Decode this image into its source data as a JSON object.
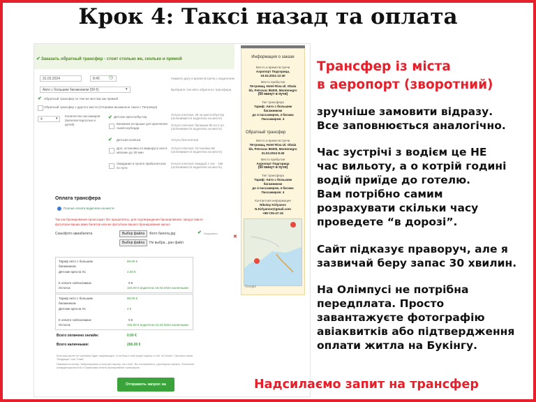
{
  "title": "Крок 4: Таксі назад та оплата",
  "form": {
    "banner": "Заказать обратный трансфер - стоит столько же, сколько и прямой",
    "date": "31.03.2024",
    "time": "8:45",
    "time_hint": "Укажите дату и время встречи с водителем",
    "car": "Авто с большим багажником (99 €)",
    "car_hint": "Выберите тип авто обратного трансфера",
    "opt_same": "Обратный трансфер по тем же местам как прямой",
    "opt_other": "Обратный трансфер с другого места (Отправка вызванное такси с Петровца)",
    "pax_label": "Количество пассажиров (включая взрослых и детей)",
    "pax_value": "4",
    "services": [
      {
        "label": "Детское кресло/бустер",
        "checked": true,
        "hint": "Услуга платная: 4€ за кресло/бустер (оплачивается водителю на месте)"
      },
      {
        "label": "Багажник на крыше для крепления лыж/сноуборда",
        "checked": false,
        "hint": "Услуга платная: багажник 8€ на 2 шт (оплачивается водителю на месте)"
      },
      {
        "label": "Детская коляска",
        "checked": true,
        "hint": "Услуга бесплатная"
      },
      {
        "label": "Доп. остановка по маршруту или в магазин до 30 мин",
        "checked": false,
        "hint": "Услуга платная: Остановка 8€ (оплачивается водителю на месте)"
      },
      {
        "label": "Ожидание в пункте прибытия или по пути",
        "checked": false,
        "hint": "Услуга платная: Каждый 1 час - 16€ (оплачивается водителю на месте)"
      }
    ],
    "payment_title": "Оплата трансфера",
    "payment_option": "Полная оплата водителю на месте",
    "payment_warning_1": "Так как бронирование происходит без предоплаты, для подтверждения бронирования, предоставьте",
    "payment_warning_2": "фото/скан ваших авиа билетов или же фото/скан вашего бронирования жилья",
    "scan_label": "Скан/фото авиабилета",
    "file_btn": "Выбор файла",
    "file1": "Фото билета.jpg",
    "file1_status": "Загружено",
    "file2": "Не выбра...ран файл",
    "table1": [
      [
        "Тариф Авто с большим",
        "99.00 €"
      ],
      [
        "багажником",
        ""
      ],
      [
        "Детские кресла Х1",
        "4.00 €"
      ],
      [
        "К оплате сейчас/аванс",
        "0 €"
      ],
      [
        "Остаток",
        "103.00 € водителю 19.03.2024 наличными"
      ]
    ],
    "table2": [
      [
        "Тариф Авто с большим",
        "99.00 €"
      ],
      [
        "багажником",
        ""
      ],
      [
        "Детские кресла Х1",
        "4 €"
      ],
      [
        "К оплате сейчас/аванс",
        "0 €"
      ],
      [
        "Остаток",
        "103.00 € водителю 31.03.2024 наличными"
      ]
    ],
    "total_online_label": "Всего оплачено онлайн:",
    "total_online_value": "0.00 €",
    "total_cash_label": "Всего наличными:",
    "total_cash_value": "206.00 €",
    "fine_print_1": "Если ваш вылет не трансфер будет подтвержден, то на Ваш e-mail придет ваучер и счёт об оплате. Смотрите папки",
    "fine_print_2": "\"Входящие\" или \"Спам\".",
    "fine_print_3": "Нажимая на кнопку \"Забронировать и получить ваучер, на e-mail\", Вы соглашаетесь с Договором оферты, Политикой",
    "fine_print_4": "конфиденциальности и Правилами оплаты бронирования трансферов.",
    "submit": "Отправить запрос на трансфер"
  },
  "side_panel": {
    "header": "Информация о заказе",
    "l1": "Место и время встречи",
    "l2": "Аэропорт Подгорица,",
    "l3": "19.03.2024 12:40",
    "l4": "Место прибытия",
    "l5": "Петровац, Hotel Riva Ul. Obala",
    "l6": "bb, Petrovac 85300, Montenegro",
    "l7": "(50 минут в пути)",
    "l8": "Тип трансфера",
    "l9": "Тариф: Авто с большим",
    "l10": "багажником",
    "l11": "до 4 пассажиров, 4 багажа",
    "l12": "Пассажиров: 4",
    "return_header": "Обратный трансфер",
    "r1": "Место и время встречи",
    "r2": "Петровац, Hotel Riva Ul. Obala",
    "r3": "bb, Petrovac 85300, Montenegro",
    "r4": "31.03.2024 8:45",
    "r5": "Место прибытия",
    "r6": "Аэропорт Подгорица",
    "r7": "(50 минут в пути)",
    "r8": "Тип трансфера",
    "r9": "Тариф: Авто с большим",
    "r10": "багажником",
    "r11": "до 4 пассажиров, 4 багажа",
    "r12": "Пассажиров: 4",
    "c1": "Контактная информация",
    "c2": "Nikolay Kirlyanov",
    "c3": "N.Kirlyanov@gmail.com",
    "c4": "+99-725-47-15"
  },
  "notes": {
    "heading_1": "Трансфер із міста",
    "heading_2": "в аеропорт (зворотний)",
    "p1_1": "зручніше замовити відразу.",
    "p1_2": "Все заповнюється аналогічно.",
    "p2_1": "Час зустрічі з водієм це НЕ",
    "p2_2": "час вильоту, а о котрій годині",
    "p2_3": "водій приїде до готелю.",
    "p2_4": "Вам потрібно самим",
    "p2_5": "розрахувати скільки часу",
    "p2_6": "проведете “в дорозі”.",
    "p3_1": "Сайт підказує праворуч, але я",
    "p3_2": "зазвичай беру запас 30 хвилин.",
    "p4_1": "На Олімпусі не потрібна",
    "p4_2": "передплата. Просто",
    "p4_3": "завантажуєте фотографію",
    "p4_4": "авіаквитків або підтвердження",
    "p4_5": "оплати житла на Букінгу.",
    "footer": "Надсилаємо запит на трансфер"
  },
  "colors": {
    "accent_red": "#e5202b",
    "green": "#3aa33a",
    "panel": "#fdf6dc"
  }
}
